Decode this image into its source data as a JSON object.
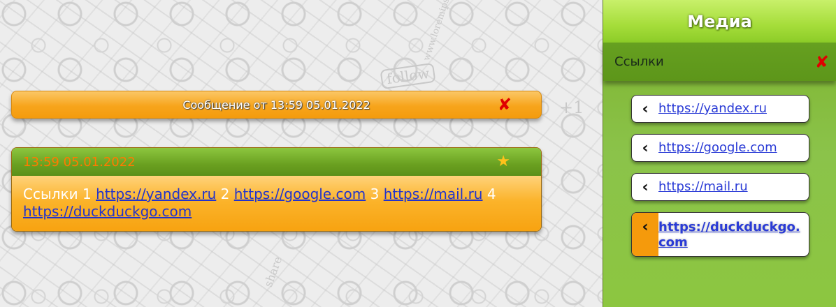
{
  "message_bar": {
    "title": "Сообщение от 13:59 05.01.2022",
    "close_symbol": "✘"
  },
  "message_card": {
    "date": "13:59 05.01.2022",
    "star_symbol": "★",
    "prefix": "Ссылки",
    "links": [
      {
        "num": "1",
        "url": "https://yandex.ru"
      },
      {
        "num": "2",
        "url": "https://google.com"
      },
      {
        "num": "3",
        "url": "https://mail.ru"
      },
      {
        "num": "4",
        "url": "https://duckduckgo.com"
      }
    ]
  },
  "sidebar": {
    "title": "Медиа",
    "section": "Ссылки",
    "close_symbol": "✘",
    "chevron": "‹",
    "links": [
      {
        "url": "https://yandex.ru",
        "active": false
      },
      {
        "url": "https://google.com",
        "active": false
      },
      {
        "url": "https://mail.ru",
        "active": false
      },
      {
        "url": "https://duckduckgo.com",
        "active": true
      }
    ]
  },
  "background": {
    "doodle_texts": [
      "follow",
      "www.loremipsum.com",
      "share",
      "+1"
    ]
  },
  "colors": {
    "orange": "#f7a51c",
    "green_dark": "#5d961a",
    "green_light": "#a5dd3a",
    "link_blue": "#2a3bd6",
    "close_red": "#e00000",
    "star_gold": "#ffc21a"
  }
}
